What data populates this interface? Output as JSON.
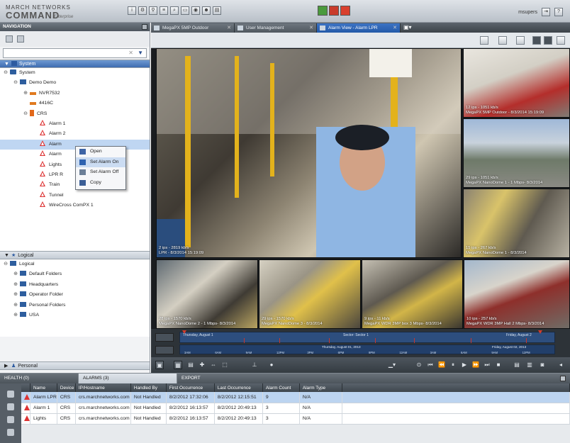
{
  "app": {
    "brand_top": "MARCH NETWORKS",
    "brand_main": "COMMAND",
    "brand_sub": "Enterprise",
    "toolbar_icons": [
      "info-icon",
      "gear-icon",
      "filter-icon",
      "list-icon",
      "search-icon",
      "device-icon",
      "camera-icon",
      "users-icon",
      "report-icon"
    ],
    "alert_icons": [
      "notification-green-icon",
      "notification-red-icon",
      "alarm-red-icon"
    ],
    "user": {
      "name": "msupers"
    }
  },
  "navigation": {
    "title": "NAVIGATION",
    "search_placeholder": "",
    "system_section": "System",
    "tree": [
      {
        "label": "System",
        "icon": "server",
        "indent": 0,
        "exp": "-"
      },
      {
        "label": "Demo Demo",
        "icon": "folder",
        "indent": 1,
        "exp": "-"
      },
      {
        "label": "NVR7532",
        "icon": "nvr",
        "indent": 2,
        "exp": "+"
      },
      {
        "label": "4416C",
        "icon": "nvr",
        "indent": 2,
        "exp": ""
      },
      {
        "label": "CRS",
        "icon": "crs",
        "indent": 2,
        "exp": "-"
      },
      {
        "label": "Alarm 1",
        "icon": "alarm",
        "indent": 3,
        "exp": ""
      },
      {
        "label": "Alarm 2",
        "icon": "alarm",
        "indent": 3,
        "exp": ""
      },
      {
        "label": "Alarm",
        "icon": "alarm",
        "indent": 3,
        "exp": "",
        "selected": true
      },
      {
        "label": "Alarm",
        "icon": "alarm",
        "indent": 3,
        "exp": ""
      },
      {
        "label": "Lights",
        "icon": "alarm",
        "indent": 3,
        "exp": ""
      },
      {
        "label": "LPR R",
        "icon": "alarm",
        "indent": 3,
        "exp": ""
      },
      {
        "label": "Train",
        "icon": "alarm",
        "indent": 3,
        "exp": ""
      },
      {
        "label": "Tunnel",
        "icon": "alarm",
        "indent": 3,
        "exp": ""
      },
      {
        "label": "WireCross ComPX 1",
        "icon": "alarm",
        "indent": 3,
        "exp": ""
      }
    ],
    "context_menu": [
      {
        "label": "Open",
        "icon": "open-icon"
      },
      {
        "label": "Set Alarm On",
        "icon": "alarm-on-icon",
        "hover": true
      },
      {
        "label": "Set Alarm Off",
        "icon": "alarm-off-icon"
      },
      {
        "label": "Copy",
        "icon": "copy-icon"
      }
    ],
    "logical_section": "Logical",
    "logical_tree": [
      {
        "label": "Logical",
        "indent": 0,
        "exp": "-"
      },
      {
        "label": "Default Folders",
        "indent": 1,
        "exp": "+"
      },
      {
        "label": "Headquarters",
        "indent": 1,
        "exp": "+"
      },
      {
        "label": "Operator Folder",
        "indent": 1,
        "exp": "+"
      },
      {
        "label": "Personal Folders",
        "indent": 1,
        "exp": "+"
      },
      {
        "label": "USA",
        "indent": 1,
        "exp": "+"
      }
    ],
    "personal_section": "Personal"
  },
  "tabs": [
    {
      "label": "MegaPX 5MP Outdoor",
      "active": false
    },
    {
      "label": "User Management",
      "active": false
    },
    {
      "label": "Alarm View - Alarm LPR",
      "active": true
    }
  ],
  "cameras": [
    {
      "cap1": "2 ips - 2819 kb/s",
      "cap2": "LPR - 8/3/2014 15:19:09"
    },
    {
      "cap1": "12 ips - 1051 kb/s",
      "cap2": "MegaPX 5MP Outdoor - 8/3/2014 15:19:09"
    },
    {
      "cap1": "29 ips - 1051 kb/s",
      "cap2": "MegaPX NanoDome 1 - 1 Mbps- 8/3/2014"
    },
    {
      "cap1": "15 ips - 267 kb/s",
      "cap2": "MegaPX NanoDome 1 - 8/3/2014"
    },
    {
      "cap1": "28 ips - 1570 kb/s",
      "cap2": "MegaPX NanoDome 2 - 1 Mbps- 8/3/2014"
    },
    {
      "cap1": "29 ips - 1570 kb/s",
      "cap2": "MegaPX NanoDome 3 - 8/3/2014"
    },
    {
      "cap1": "9 ips - 11 kb/s",
      "cap2": "MegaPX WDR 3MP box 3 Mbps- 8/3/2014"
    },
    {
      "cap1": "10 ips - 257 kb/s",
      "cap2": "MegaPX WDR 3MP Hall 2 Mbps- 8/3/2014"
    }
  ],
  "timeline": {
    "row1_left": "Thursday, August 1",
    "row1_mid": "Sector: Sector 1",
    "row1_right": "Friday, August 2",
    "row2_mid": "Thursday, August 01, 2013",
    "row2_right": "Friday, August 02, 2013",
    "hours": [
      "3AM",
      "6AM",
      "9AM",
      "12PM",
      "3PM",
      "6PM",
      "9PM",
      "12AM",
      "3AM",
      "6AM",
      "9AM",
      "12PM"
    ]
  },
  "bottom": {
    "tabs": [
      {
        "label": "HEALTH (0)",
        "active": false
      },
      {
        "label": "ALARMS (3)",
        "active": true
      },
      {
        "label": "EXPORT",
        "active": false
      }
    ],
    "columns": [
      "",
      "Name",
      "Device",
      "IP/Hostname",
      "Handled By",
      "First Occurrence",
      "Last Occurrence",
      "Alarm Count",
      "Alarm Type"
    ],
    "rows": [
      [
        "",
        "Alarm LPR",
        "CRS",
        "crs.marchnetworks.com",
        "Not Handled",
        "8/2/2012 17:32:06",
        "8/2/2012 12:15:51",
        "9",
        "N/A"
      ],
      [
        "",
        "Alarm 1",
        "CRS",
        "crs.marchnetworks.com",
        "Not Handled",
        "8/2/2012 16:13:57",
        "8/2/2012 20:49:13",
        "3",
        "N/A"
      ],
      [
        "",
        "Lights",
        "CRS",
        "crs.marchnetworks.com",
        "Not Handled",
        "8/2/2012 16:13:57",
        "8/2/2012 20:49:13",
        "3",
        "N/A"
      ]
    ]
  },
  "colors": {
    "accent": "#2f63b0",
    "alarm": "#d33333",
    "selection": "#bcd4f0"
  }
}
